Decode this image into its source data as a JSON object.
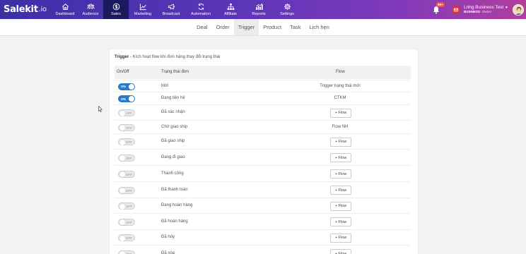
{
  "brand": {
    "name": "Salekit",
    "suffix": ".io"
  },
  "nav": [
    {
      "label": "Dashboard",
      "icon": "home-icon"
    },
    {
      "label": "Audience",
      "icon": "users-icon"
    },
    {
      "label": "Sales",
      "icon": "dollar-icon",
      "active": true
    },
    {
      "label": "Marketing",
      "icon": "chart-icon"
    },
    {
      "label": "Broadcast",
      "icon": "megaphone-icon"
    },
    {
      "label": "Automation",
      "icon": "refresh-icon"
    },
    {
      "label": "Affiliate",
      "icon": "network-icon"
    },
    {
      "label": "Reports",
      "icon": "bar-chart-icon"
    },
    {
      "label": "Settings",
      "icon": "gear-icon"
    }
  ],
  "notifications": {
    "count": "99+"
  },
  "account": {
    "name": "Lnhg Business Test",
    "plan": "BUSINESS",
    "role": "Owner"
  },
  "subnav": [
    "Deal",
    "Order",
    "Trigger",
    "Product",
    "Task",
    "Lịch hẹn"
  ],
  "subnav_active": "Trigger",
  "card": {
    "title_bold": "Trigger",
    "title_rest": " - Kích hoạt flow khi đơn hàng thay đổi trạng thái",
    "columns": {
      "onoff": "On/Off",
      "status": "Trạng thái đơn",
      "flow": "Flow"
    }
  },
  "toggle_labels": {
    "on": "ON",
    "off": "OFF"
  },
  "rows": [
    {
      "on": true,
      "status": "Mới",
      "flow": "Trigger trạng thái mới"
    },
    {
      "on": true,
      "status": "Đang liên hệ",
      "flow": "CTKM"
    },
    {
      "on": false,
      "status": "Đã xác nhận",
      "flow_button": "+ Flow"
    },
    {
      "on": false,
      "status": "Chờ giao ship",
      "flow": "Flow NH"
    },
    {
      "on": false,
      "status": "Đã giao ship",
      "flow_button": "+ Flow"
    },
    {
      "on": false,
      "status": "Đang đi giao",
      "flow_button": "+ Flow"
    },
    {
      "on": false,
      "status": "Thành công",
      "flow_button": "+ Flow"
    },
    {
      "on": false,
      "status": "Đã thanh toán",
      "flow_button": "+ Flow"
    },
    {
      "on": false,
      "status": "Đang hoàn hàng",
      "flow_button": "+ Flow"
    },
    {
      "on": false,
      "status": "Đã hoàn hàng",
      "flow_button": "+ Flow"
    },
    {
      "on": false,
      "status": "Đã hủy",
      "flow_button": "+ Flow"
    },
    {
      "on": false,
      "status": "Đã xóa",
      "flow_button": "+ Flow"
    }
  ],
  "colors": {
    "nav_start": "#3d2fa6",
    "nav_end": "#b23e9d",
    "nav_active": "#1c1a5e",
    "toggle_on": "#2b79c2"
  }
}
